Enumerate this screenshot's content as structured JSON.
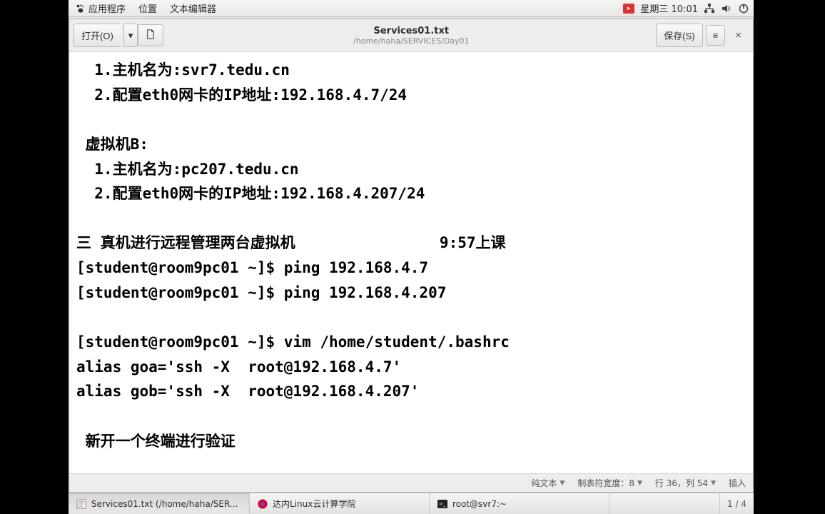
{
  "panel": {
    "applications": "应用程序",
    "places": "位置",
    "text_editor": "文本编辑器",
    "datetime": "星期三 10:01"
  },
  "toolbar": {
    "open_label": "打开(O)",
    "save_label": "保存(S)"
  },
  "document": {
    "title": "Services01.txt",
    "path": "/home/haha/SERVICES/Day01",
    "content": "  1.主机名为:svr7.tedu.cn\n  2.配置eth0网卡的IP地址:192.168.4.7/24\n\n 虚拟机B:\n  1.主机名为:pc207.tedu.cn\n  2.配置eth0网卡的IP地址:192.168.4.207/24\n\n三 真机进行远程管理两台虚拟机                9:57上课\n[student@room9pc01 ~]$ ping 192.168.4.7\n[student@room9pc01 ~]$ ping 192.168.4.207\n\n[student@room9pc01 ~]$ vim /home/student/.bashrc\nalias goa='ssh -X  root@192.168.4.7'\nalias gob='ssh -X  root@192.168.4.207'\n\n 新开一个终端进行验证"
  },
  "statusbar": {
    "syntax": "纯文本",
    "tab_width": "制表符宽度：8",
    "position": "行 36，列 54",
    "mode": "插入"
  },
  "taskbar": {
    "items": [
      "Services01.txt (/home/haha/SERVIC…",
      "达内Linux云计算学院",
      "root@svr7:~"
    ],
    "pager": "1 / 4"
  }
}
